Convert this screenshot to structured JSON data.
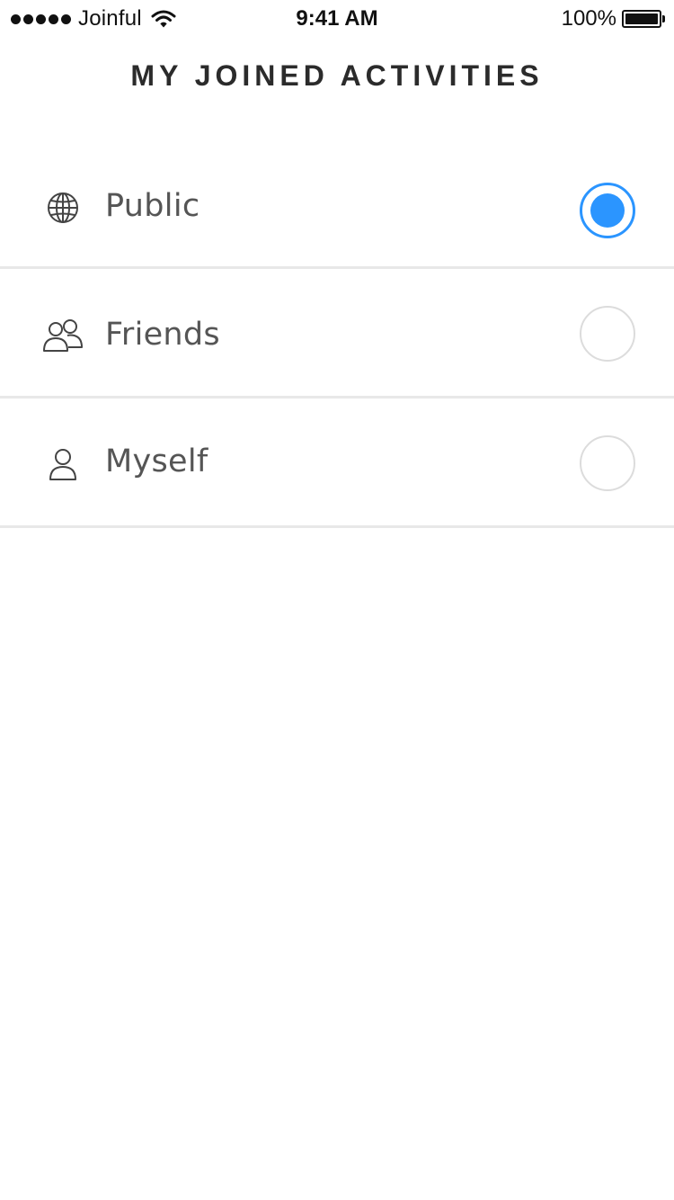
{
  "status_bar": {
    "carrier": "Joinful",
    "time": "9:41 AM",
    "battery": "100%",
    "icons": [
      "signal-dots-icon",
      "wifi-icon",
      "battery-icon"
    ]
  },
  "header": {
    "title": "MY JOINED ACTIVITIES"
  },
  "options": [
    {
      "label": "Public",
      "icon": "globe-icon",
      "selected": true
    },
    {
      "label": "Friends",
      "icon": "friends-icon",
      "selected": false
    },
    {
      "label": "Myself",
      "icon": "person-icon",
      "selected": false
    }
  ],
  "colors": {
    "accent": "#2b95ff",
    "divider": "#e8e8e8",
    "radio_border": "#dcdcdc",
    "label_text": "#555555",
    "title_text": "#2b2b2b"
  }
}
